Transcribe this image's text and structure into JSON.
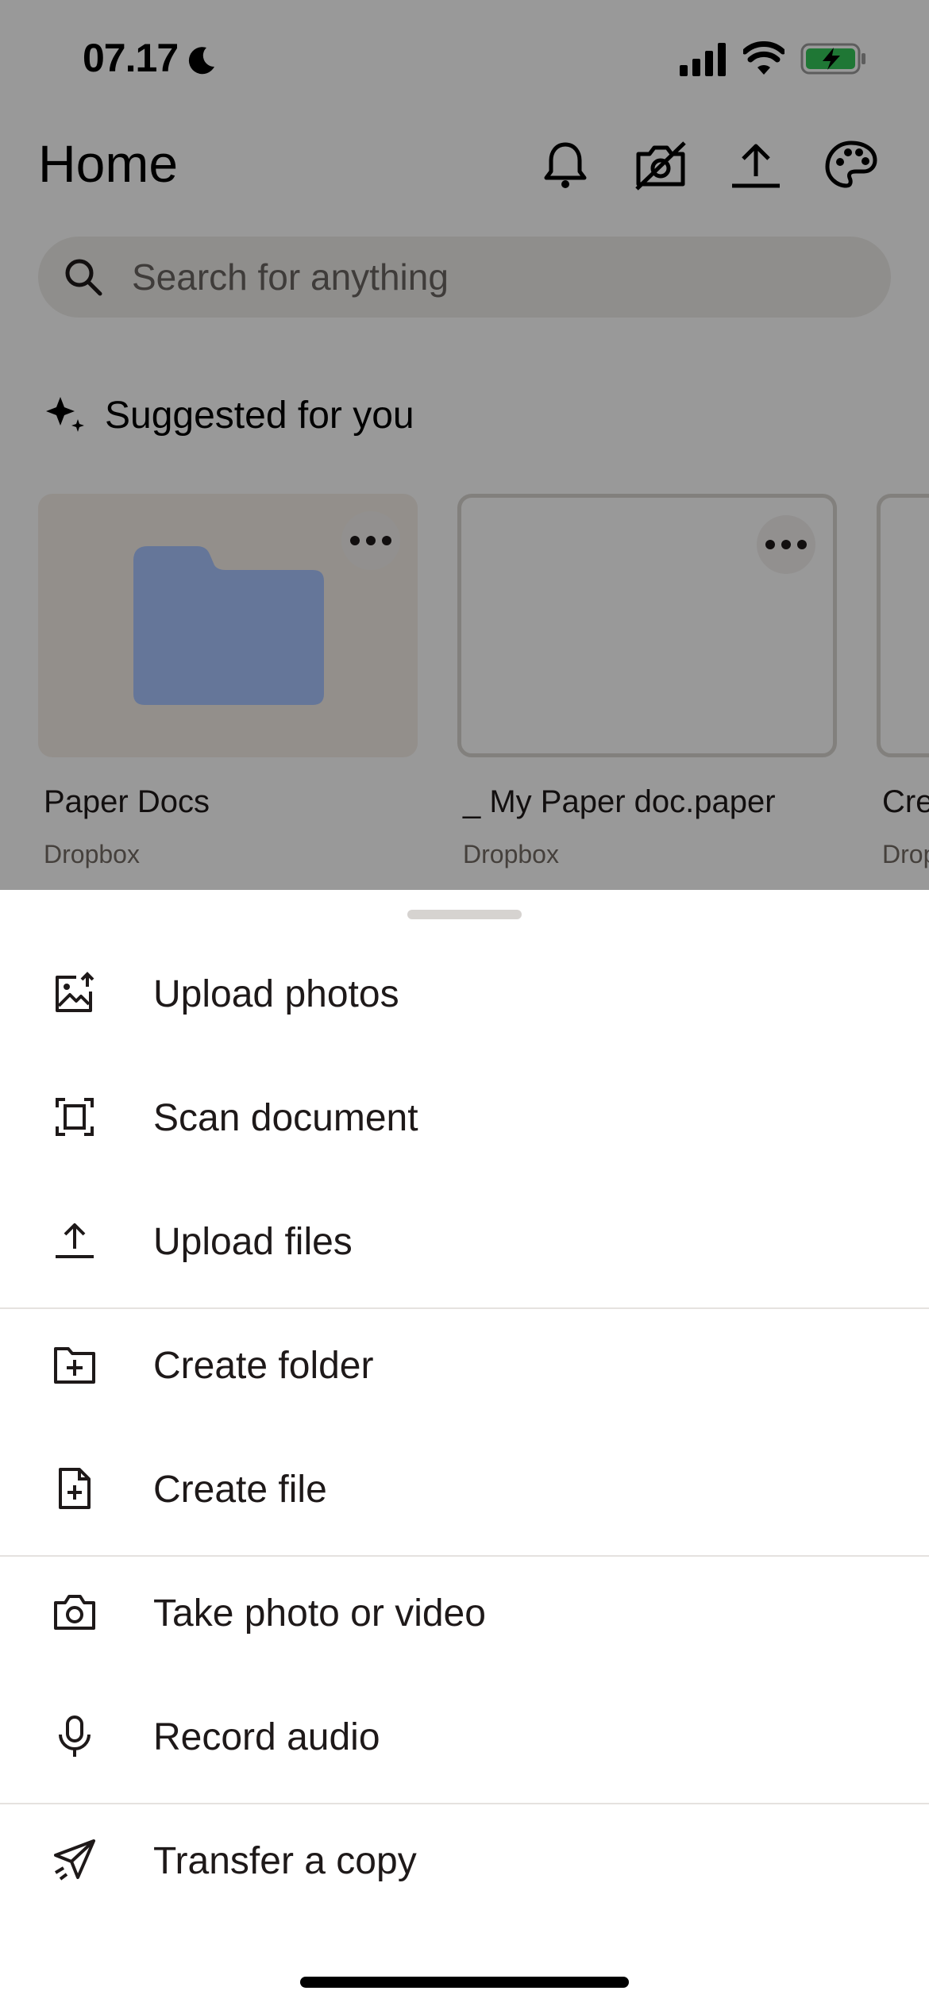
{
  "status_bar": {
    "time": "07.17"
  },
  "header": {
    "title": "Home",
    "icons": [
      "bell-icon",
      "camera-off-icon",
      "upload-icon",
      "palette-icon"
    ]
  },
  "search": {
    "placeholder": "Search for anything"
  },
  "suggested": {
    "title": "Suggested for you",
    "items": [
      {
        "name": "Paper Docs",
        "location": "Dropbox",
        "type": "folder"
      },
      {
        "name": "_ My Paper doc.paper",
        "location": "Dropbox",
        "type": "paper"
      },
      {
        "name": "Cre",
        "location": "Drop",
        "type": "file"
      }
    ]
  },
  "sheet": {
    "items": [
      {
        "label": "Upload photos",
        "icon": "upload-photos-icon"
      },
      {
        "label": "Scan document",
        "icon": "scan-document-icon"
      },
      {
        "label": "Upload files",
        "icon": "upload-icon"
      },
      {
        "label": "Create folder",
        "icon": "create-folder-icon"
      },
      {
        "label": "Create file",
        "icon": "create-file-icon"
      },
      {
        "label": "Take photo or video",
        "icon": "camera-icon"
      },
      {
        "label": "Record audio",
        "icon": "microphone-icon"
      },
      {
        "label": "Transfer a copy",
        "icon": "send-icon"
      }
    ]
  },
  "colors": {
    "accent": "#0061fe",
    "folder": "#a8c5ff",
    "battery": "#34c759"
  }
}
